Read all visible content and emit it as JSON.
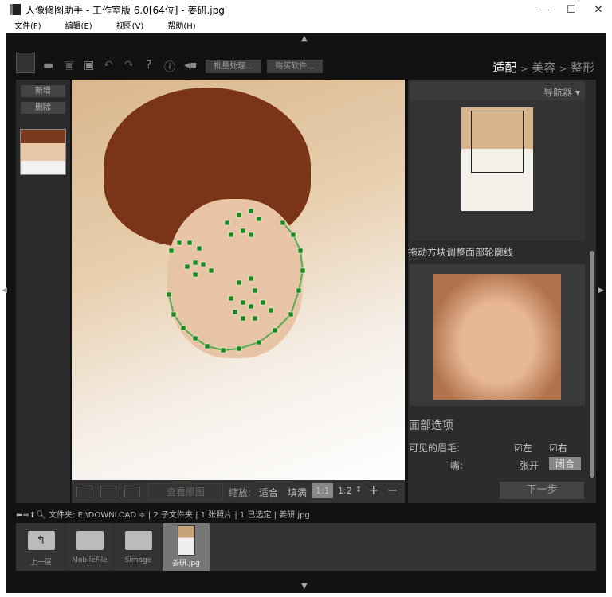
{
  "window": {
    "title": "人像修图助手 - 工作室版 6.0[64位] - 姜研.jpg",
    "minimize": "—",
    "maximize": "☐",
    "close": "✕"
  },
  "menu": [
    "文件(F)",
    "编辑(E)",
    "视图(V)",
    "帮助(H)"
  ],
  "toolbar": {
    "batch": "批量处理...",
    "buy": "购买软件...",
    "help": "?",
    "info": "ⓘ"
  },
  "workflow": {
    "step1": "适配",
    "sep": ">",
    "step2": "美容",
    "step3": "整形"
  },
  "left": {
    "add": "新增",
    "delete": "删除"
  },
  "navigator": {
    "title": "导航器 ▾"
  },
  "landmarks": {
    "title": "拖动方块调整面部轮廓线"
  },
  "face_options": {
    "title": "面部选项",
    "eyebrows_label": "可见的眉毛:",
    "left": "左",
    "right": "右",
    "mouth_label": "嘴:",
    "open": "张开",
    "closed": "闭合",
    "left_checked": true,
    "right_checked": true,
    "mouth_selected": "闭合"
  },
  "next_button": "下一步",
  "viewbar": {
    "view_original": "查看原图",
    "zoom_label": "缩放:",
    "fit": "适合",
    "fill": "填满",
    "one_one": "1:1",
    "one_two": "1:2",
    "plus": "+",
    "minus": "−"
  },
  "pathbar": {
    "folder_label": "文件夹:",
    "path": "E:\\DOWNLOAD ≑",
    "info": "| 2 子文件夹 | 1 张照片 | 1 已选定 | 姜研.jpg"
  },
  "files": [
    {
      "name": "上一层",
      "type": "up"
    },
    {
      "name": "MobileFile",
      "type": "folder"
    },
    {
      "name": "Simage",
      "type": "folder"
    },
    {
      "name": "姜研.jpg",
      "type": "image",
      "selected": true
    }
  ],
  "colors": {
    "landmark": "#1a8a1a",
    "bg": "#121212",
    "panel": "#2c2c2c"
  }
}
